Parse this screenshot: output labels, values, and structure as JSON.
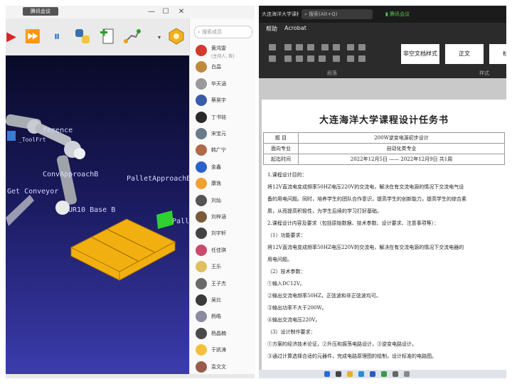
{
  "left_window": {
    "title": "腾讯会议",
    "controls": [
      "—",
      "☐",
      "✕"
    ],
    "toolbar_icons": [
      "run-icon",
      "fast-forward-icon",
      "pause-icon",
      "python-icon",
      "add-program-icon",
      "path-icon",
      "dropdown-icon",
      "settings-icon"
    ],
    "viewport_labels": {
      "reference": "ference",
      "tool": "_ToolFrt",
      "approach": "ConvApproachB",
      "pallet_approach": "PalletApproachB",
      "conveyor": "Get Conveyor",
      "base": "UR10 Base B",
      "pallet": "Pall"
    },
    "contacts": {
      "search_placeholder": "搜索成员",
      "items": [
        {
          "name": "黄鸿雷",
          "sub": "(主持人, 我)",
          "color": "#d33a2c"
        },
        {
          "name": "白皛",
          "color": "#c08a3e"
        },
        {
          "name": "毕天涵",
          "color": "#9a9a9a"
        },
        {
          "name": "蔡昊宇",
          "color": "#3b5aa8"
        },
        {
          "name": "丁书铭",
          "color": "#2a2a2a"
        },
        {
          "name": "宋宝元",
          "color": "#6b7b8c"
        },
        {
          "name": "韩广宁",
          "color": "#b06a4a"
        },
        {
          "name": "金鑫",
          "color": "#2a62c9"
        },
        {
          "name": "康逸",
          "color": "#f0a030"
        },
        {
          "name": "刘灿",
          "color": "#555"
        },
        {
          "name": "刘梓涵",
          "color": "#7a5a3a"
        },
        {
          "name": "刘宇轩",
          "color": "#444"
        },
        {
          "name": "任佳琪",
          "color": "#c94a6a"
        },
        {
          "name": "王乐",
          "color": "#e0c060"
        },
        {
          "name": "王子杰",
          "color": "#6a6a6a"
        },
        {
          "name": "吴比",
          "color": "#3a3a3a"
        },
        {
          "name": "杨皓",
          "color": "#8a8aa0"
        },
        {
          "name": "杨晶楠",
          "color": "#4a4a4a"
        },
        {
          "name": "于凯涛",
          "color": "#f5c040"
        },
        {
          "name": "袁文文",
          "color": "#9a5a4a"
        }
      ]
    }
  },
  "right_window": {
    "title": "大连海洋大学课程设计任务书.docx",
    "search_label": "搜索(Alt+Q)",
    "badge": "腾讯会议",
    "menu": [
      "帮助",
      "Acrobat"
    ],
    "styles": [
      "非空文档样式",
      "正文",
      "标题"
    ],
    "group_labels": [
      "段落",
      "样式"
    ],
    "doc": {
      "title": "大连海洋大学课程设计任务书",
      "table": [
        [
          "题  目",
          "200W逆变电源初步设计"
        ],
        [
          "面向专业",
          "自动化类专业"
        ],
        [
          "起迄时间",
          "2022年12月5日 —— 2022年12月9日  共1周"
        ]
      ],
      "lines": [
        "1.课程设计目的：",
        "    将12V直流电变成频率50HZ电压220V的交流电，解决在有交流电源的情况下交流电气设",
        "备的用电问题。同时，培养学生的团队合作意识，提高学生的创新能力，提高学生的综合素",
        "质，从而提高积极性，为学生后续的学习打好基础。",
        "2.课程设计内容及要求（包括原始数据、技术参数、设计要求、注意事项等）：",
        "（1）功能要求：",
        "    将12V直流电变成频率50HZ电压220V的交流电，解决在有交流电源的情况下交流电器的",
        "用电问题。",
        "（2）技术参数：",
        "①输入DC12V。",
        "②输出交流电频率50HZ，正弦波和非正弦波均可。",
        "③输出功率不大于200W。",
        "④输出交流电压220V。",
        "（3）设计制作要求：",
        "①方案的经济技术论证，②升压和振荡电路设计，③逆变电路设计。",
        "③通过计算选择合适的元器件，完成电路原理图的绘制，设计标准的电路图。"
      ]
    }
  }
}
